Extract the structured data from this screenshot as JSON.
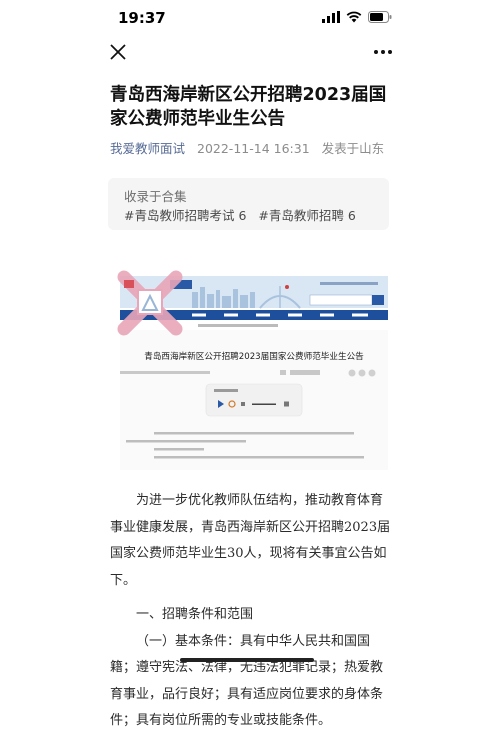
{
  "status_bar": {
    "time": "19:37"
  },
  "nav": {
    "close_icon": "close-icon",
    "more_icon": "more-icon"
  },
  "article": {
    "title": "青岛西海岸新区公开招聘2023届国家公费师范毕业生公告",
    "author": "我爱教师面试",
    "date": "2022-11-14 16:31",
    "location": "发表于山东"
  },
  "collection": {
    "label": "收录于合集",
    "tags": [
      "#青岛教师招聘考试 6",
      "#青岛教师招聘 6"
    ]
  },
  "embedded_screenshot": {
    "page_title": "青岛西海岸新区公开招聘2023届国家公费师范毕业生公告"
  },
  "body": {
    "para1": "为进一步优化教师队伍结构，推动教育体育事业健康发展，青岛西海岸新区公开招聘2023届国家公费师范毕业生30人，现将有关事宜公告如下。",
    "heading1": "一、招聘条件和范围",
    "para2": "（一）基本条件：具有中华人民共和国国籍；遵守宪法、法律，无违法犯罪记录；热爱教育事业，品行良好；具有适应岗位要求的身体条件；具有岗位所需的专业或技能条件。"
  },
  "colors": {
    "link": "#576b95",
    "meta": "#8c8c8c",
    "collection_bg": "#f5f5f5",
    "watermark": "#e8a6b8",
    "site_nav": "#1e4f9c"
  }
}
